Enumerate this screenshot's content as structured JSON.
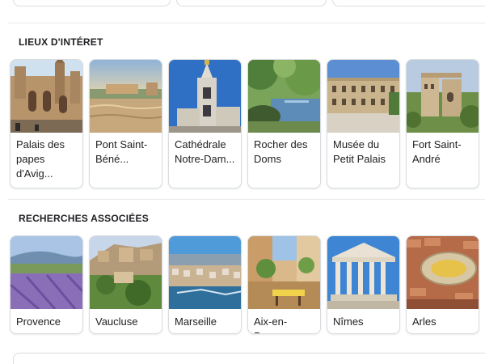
{
  "points_of_interest": {
    "title": "LIEUX D'INTÉRET",
    "items": [
      {
        "label": "Palais des papes d'Avig...",
        "image": "palais-des-papes-photo"
      },
      {
        "label": "Pont Saint-Béné...",
        "image": "pont-saint-benezet-photo"
      },
      {
        "label": "Cathédrale Notre-Dam...",
        "image": "cathedrale-notre-dame-photo"
      },
      {
        "label": "Rocher des Doms",
        "image": "rocher-des-doms-photo"
      },
      {
        "label": "Musée du Petit Palais",
        "image": "musee-petit-palais-photo"
      },
      {
        "label": "Fort Saint-André",
        "image": "fort-saint-andre-photo"
      }
    ]
  },
  "related_searches": {
    "title": "RECHERCHES ASSOCIÉES",
    "items": [
      {
        "label": "Provence",
        "image": "provence-lavender-photo"
      },
      {
        "label": "Vaucluse",
        "image": "vaucluse-village-photo"
      },
      {
        "label": "Marseille",
        "image": "marseille-harbor-photo"
      },
      {
        "label": "Aix-en-Prov...",
        "image": "aix-en-provence-square-photo"
      },
      {
        "label": "Nîmes",
        "image": "nimes-maison-carree-photo"
      },
      {
        "label": "Arles",
        "image": "arles-arena-photo"
      }
    ]
  },
  "colors": {
    "card_border": "#dadce0",
    "divider": "#e8eaed",
    "text": "#202124"
  }
}
